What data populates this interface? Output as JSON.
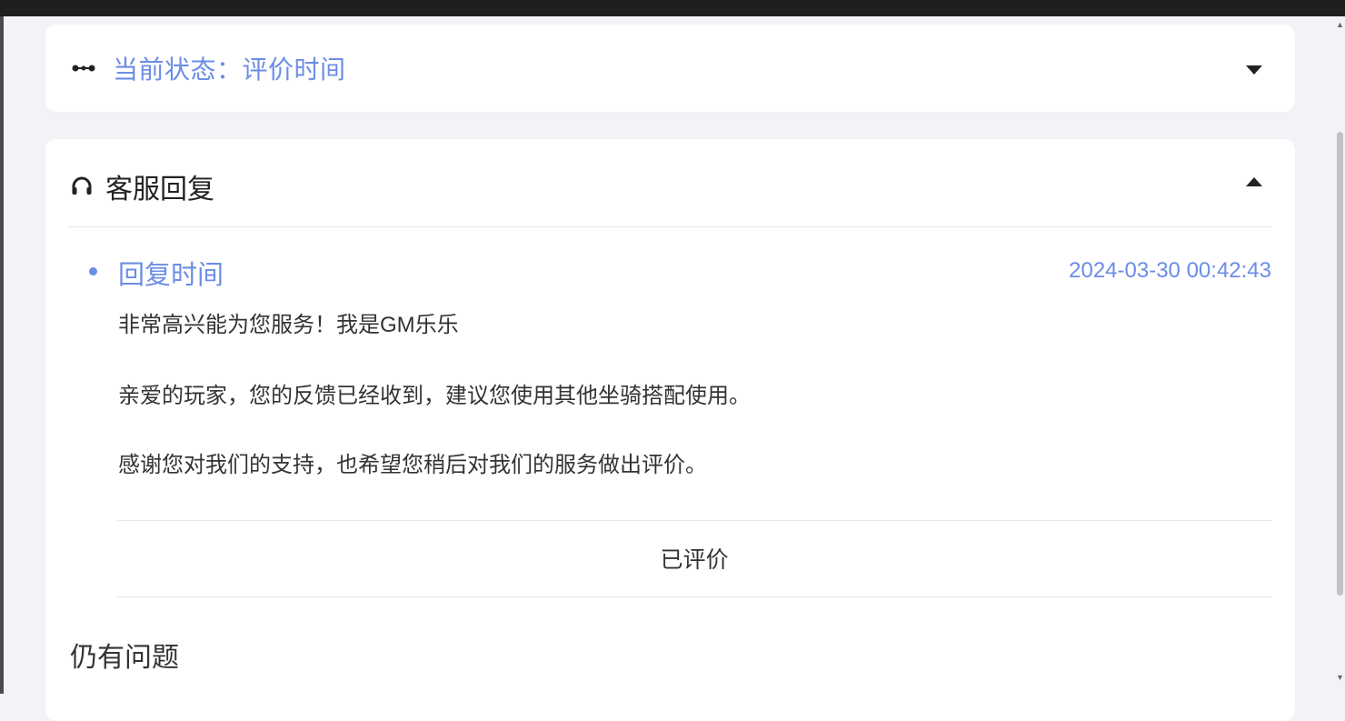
{
  "status_card": {
    "status_text": "当前状态：评价时间",
    "icon": "status-dots-icon",
    "toggle_icon": "caret-down-icon"
  },
  "reply_card": {
    "title": "客服回复",
    "icon": "headset-icon",
    "toggle_icon": "caret-up-icon",
    "reply": {
      "time_label": "回复时间",
      "time_value": "2024-03-30 00:42:43",
      "messages": [
        "非常高兴能为您服务！我是GM乐乐",
        "亲爱的玩家，您的反馈已经收到，建议您使用其他坐骑搭配使用。",
        "感谢您对我们的支持，也希望您稍后对我们的服务做出评价。"
      ]
    },
    "rated_label": "已评价",
    "still_issue_label": "仍有问题"
  },
  "colors": {
    "accent": "#6b8de6",
    "background": "#f2f3f7",
    "card": "#ffffff",
    "text": "#333333"
  }
}
